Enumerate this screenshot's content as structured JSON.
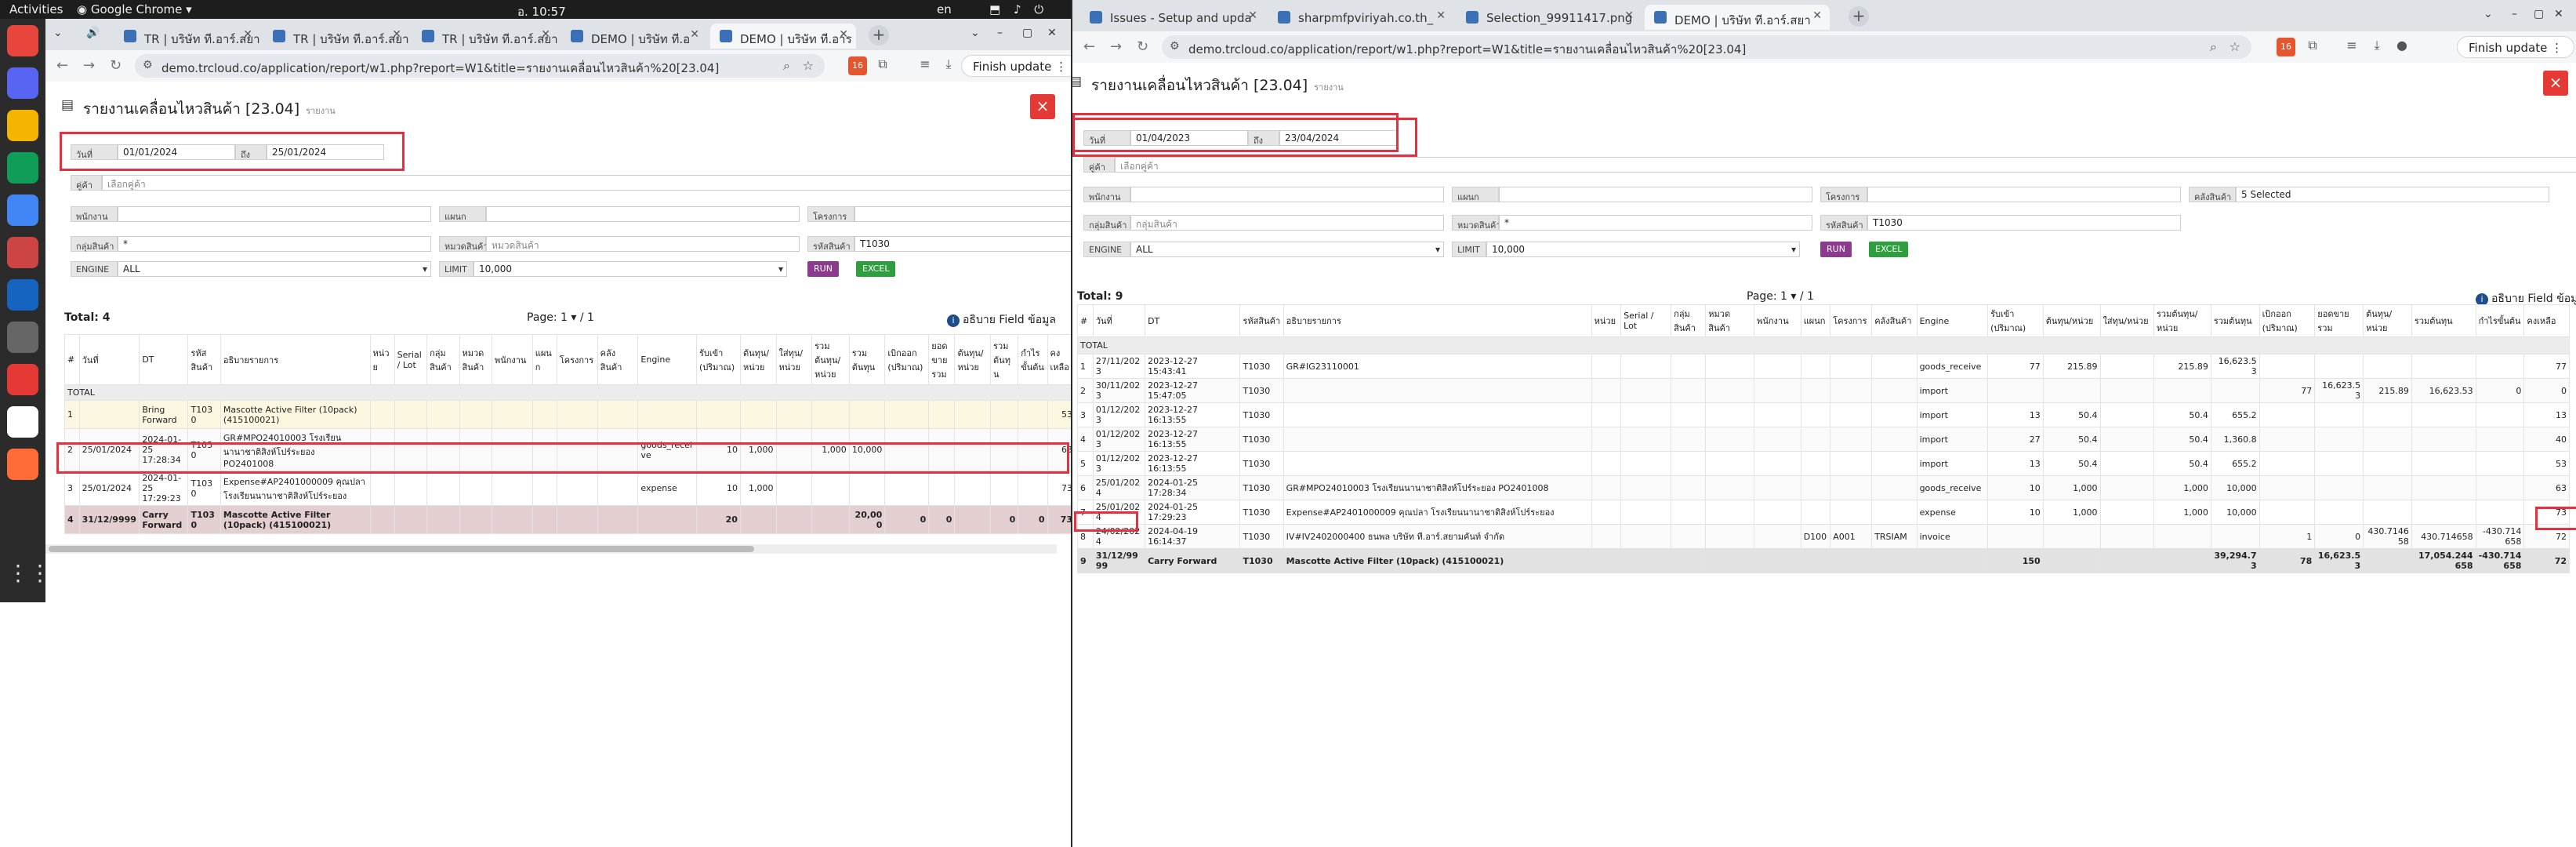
{
  "topbar": {
    "activities": "Activities",
    "app_name": "Google Chrome",
    "clock": "อ. 10:57",
    "lang": "en",
    "tray": "⬒ ♪ ⏻"
  },
  "dock": {
    "icons": [
      "chrome-icon",
      "discord-icon",
      "slides-icon",
      "sheets-icon",
      "docs-icon",
      "app-icon",
      "globe-icon",
      "calculator-icon",
      "anydesk-icon",
      "editor-icon",
      "postman-icon"
    ]
  },
  "left": {
    "tabs": [
      {
        "label": "TR | บริษัท ที.อาร์.สยา"
      },
      {
        "label": "TR | บริษัท ที.อาร์.สยา"
      },
      {
        "label": "TR | บริษัท ที.อาร์.สยา"
      },
      {
        "label": "DEMO | บริษัท ที.อ"
      },
      {
        "label": "DEMO | บริษัท ที.อาร"
      }
    ],
    "url": "demo.trcloud.co/application/report/w1.php?report=W1&title=รายงานเคลื่อนไหวสินค้า%20[23.04]",
    "ext_badge": "16",
    "finish_update": "Finish update",
    "report": {
      "title": "รายงานเคลื่อนไหวสินค้า [23.04]",
      "subtitle": "รายงาน",
      "date_label": "วันที่",
      "date_from": "01/01/2024",
      "to_label": "ถึง",
      "date_to": "25/01/2024",
      "customer_label": "คู่ค้า",
      "customer_placeholder": "เลือกคู่ค้า",
      "employee_label": "พนักงาน",
      "dept_label": "แผนก",
      "project_label": "โครงการ",
      "group_label": "กลุ่มสินค้า",
      "group_value": "*",
      "unit_label": "หมวดสินค้า",
      "unit_placeholder": "หมวดสินค้า",
      "code_label": "รหัสสินค้า",
      "code_value": "T1030",
      "engine_label": "ENGINE",
      "engine_value": "ALL",
      "limit_label": "LIMIT",
      "limit_value": "10,000",
      "run": "RUN",
      "excel": "EXCEL",
      "total": "Total: 4",
      "page": "Page: 1 ▾ / 1",
      "info": "อธิบาย Field ข้อมูล",
      "headers": [
        "#",
        "วันที่",
        "DT",
        "รหัสสินค้า",
        "อธิบายรายการ",
        "หน่วย",
        "Serial / Lot",
        "กลุ่มสินค้า",
        "หมวดสินค้า",
        "พนักงาน",
        "แผนก",
        "โครงการ",
        "คลังสินค้า",
        "Engine",
        "รับเข้า (ปริมาณ)",
        "ต้นทุน/หน่วย",
        "ใส่ทุน/หน่วย",
        "รวมต้นทุน/หน่วย",
        "รวมต้นทุน",
        "เบิกออก (ปริมาณ)",
        "ยอดขายรวม",
        "ต้นทุน/หน่วย",
        "รวมต้นทุน",
        "กำไรขั้นต้น",
        "คงเหลือ"
      ],
      "total_row": "TOTAL",
      "rows": [
        [
          "1",
          "",
          "Bring Forward",
          "T1030",
          "Mascotte Active Filter (10pack) (415100021)",
          "",
          "",
          "",
          "",
          "",
          "",
          "",
          "",
          "",
          "",
          "",
          "",
          "",
          "",
          "",
          "",
          "",
          "",
          "",
          "53"
        ],
        [
          "2",
          "25/01/2024",
          "2024-01-25 17:28:34",
          "T1030",
          "GR#MPO24010003 โรงเรียนนานาชาติสิงห์โปร์ระยอง PO2401008",
          "",
          "",
          "",
          "",
          "",
          "",
          "",
          "",
          "goods_receive",
          "10",
          "1,000",
          "",
          "1,000",
          "10,000",
          "",
          "",
          "",
          "",
          "",
          "63"
        ],
        [
          "3",
          "25/01/2024",
          "2024-01-25 17:29:23",
          "T1030",
          "Expense#AP2401000009 คุณปลา โรงเรียนนานาชาติสิงห์โปร์ระยอง",
          "",
          "",
          "",
          "",
          "",
          "",
          "",
          "",
          "expense",
          "10",
          "1,000",
          "",
          "",
          "",
          "",
          "",
          "",
          "",
          "",
          "73"
        ],
        [
          "4",
          "31/12/9999",
          "Carry Forward",
          "T1030",
          "Mascotte Active Filter (10pack) (415100021)",
          "",
          "",
          "",
          "",
          "",
          "",
          "",
          "",
          "",
          "20",
          "",
          "",
          "",
          "20,000",
          "0",
          "0",
          "",
          "0",
          "0",
          "73"
        ]
      ]
    }
  },
  "right": {
    "tabs": [
      {
        "label": "Issues - Setup and upda"
      },
      {
        "label": "sharpmfpviriyah.co.th_"
      },
      {
        "label": "Selection_99911417.png"
      },
      {
        "label": "DEMO | บริษัท ที.อาร์.สยา"
      }
    ],
    "url": "demo.trcloud.co/application/report/w1.php?report=W1&title=รายงานเคลื่อนไหวสินค้า%20[23.04]",
    "ext_badge": "16",
    "finish_update": "Finish update",
    "report": {
      "title": "รายงานเคลื่อนไหวสินค้า [23.04]",
      "subtitle": "รายงาน",
      "date_label": "วันที่",
      "date_from": "01/04/2023",
      "to_label": "ถึง",
      "date_to": "23/04/2024",
      "customer_label": "คู่ค้า",
      "customer_placeholder": "เลือกคู่ค้า",
      "employee_label": "พนักงาน",
      "dept_label": "แผนก",
      "project_label": "โครงการ",
      "warehouse_label": "คลังสินค้า",
      "warehouse_value": "5 Selected",
      "group_label": "กลุ่มสินค้า",
      "group_placeholder": "กลุ่มสินค้า",
      "unit_label": "หมวดสินค้า",
      "unit_value": "*",
      "code_label": "รหัสสินค้า",
      "code_value": "T1030",
      "engine_label": "ENGINE",
      "engine_value": "ALL",
      "limit_label": "LIMIT",
      "limit_value": "10,000",
      "run": "RUN",
      "excel": "EXCEL",
      "total": "Total: 9",
      "page": "Page: 1 ▾ / 1",
      "info": "อธิบาย Field ข้อมูล",
      "headers": [
        "#",
        "วันที่",
        "DT",
        "รหัสสินค้า",
        "อธิบายรายการ",
        "หน่วย",
        "Serial / Lot",
        "กลุ่มสินค้า",
        "หมวดสินค้า",
        "พนักงาน",
        "แผนก",
        "โครงการ",
        "คลังสินค้า",
        "Engine",
        "รับเข้า (ปริมาณ)",
        "ต้นทุน/หน่วย",
        "ใส่ทุน/หน่วย",
        "รวมต้นทุน/หน่วย",
        "รวมต้นทุน",
        "เบิกออก (ปริมาณ)",
        "ยอดขายรวม",
        "ต้นทุน/หน่วย",
        "รวมต้นทุน",
        "กำไรขั้นต้น",
        "คงเหลือ"
      ],
      "total_row": "TOTAL",
      "rows": [
        [
          "1",
          "27/11/2023",
          "2023-12-27 15:43:41",
          "T1030",
          "GR#IG23110001",
          "",
          "",
          "",
          "",
          "",
          "",
          "",
          "",
          "goods_receive",
          "77",
          "215.89",
          "",
          "215.89",
          "16,623.53",
          "",
          "",
          "",
          "",
          "",
          "77"
        ],
        [
          "2",
          "30/11/2023",
          "2023-12-27 15:47:05",
          "T1030",
          "",
          "",
          "",
          "",
          "",
          "",
          "",
          "",
          "",
          "import",
          "",
          "",
          "",
          "",
          "",
          "77",
          "16,623.53",
          "215.89",
          "16,623.53",
          "0",
          "0"
        ],
        [
          "3",
          "01/12/2023",
          "2023-12-27 16:13:55",
          "T1030",
          "",
          "",
          "",
          "",
          "",
          "",
          "",
          "",
          "",
          "import",
          "13",
          "50.4",
          "",
          "50.4",
          "655.2",
          "",
          "",
          "",
          "",
          "",
          "13"
        ],
        [
          "4",
          "01/12/2023",
          "2023-12-27 16:13:55",
          "T1030",
          "",
          "",
          "",
          "",
          "",
          "",
          "",
          "",
          "",
          "import",
          "27",
          "50.4",
          "",
          "50.4",
          "1,360.8",
          "",
          "",
          "",
          "",
          "",
          "40"
        ],
        [
          "5",
          "01/12/2023",
          "2023-12-27 16:13:55",
          "T1030",
          "",
          "",
          "",
          "",
          "",
          "",
          "",
          "",
          "",
          "import",
          "13",
          "50.4",
          "",
          "50.4",
          "655.2",
          "",
          "",
          "",
          "",
          "",
          "53"
        ],
        [
          "6",
          "25/01/2024",
          "2024-01-25 17:28:34",
          "T1030",
          "GR#MPO24010003 โรงเรียนนานาชาติสิงห์โปร์ระยอง PO2401008",
          "",
          "",
          "",
          "",
          "",
          "",
          "",
          "",
          "goods_receive",
          "10",
          "1,000",
          "",
          "1,000",
          "10,000",
          "",
          "",
          "",
          "",
          "",
          "63"
        ],
        [
          "7",
          "25/01/2024",
          "2024-01-25 17:29:23",
          "T1030",
          "Expense#AP2401000009 คุณปลา โรงเรียนนานาชาติสิงห์โปร์ระยอง",
          "",
          "",
          "",
          "",
          "",
          "",
          "",
          "",
          "expense",
          "10",
          "1,000",
          "",
          "1,000",
          "10,000",
          "",
          "",
          "",
          "",
          "",
          "73"
        ],
        [
          "8",
          "24/02/2024",
          "2024-04-19 16:14:37",
          "T1030",
          "IV#IV2402000400 ธนพล บริษัท ที.อาร์.สยามคันท์ จำกัด",
          "",
          "",
          "",
          "",
          "",
          "D100",
          "A001",
          "TRSIAM",
          "invoice",
          "",
          "",
          "",
          "",
          "",
          "1",
          "0",
          "430.714658",
          "430.714658",
          "-430.714658",
          "72"
        ],
        [
          "9",
          "31/12/9999",
          "Carry Forward",
          "T1030",
          "Mascotte Active Filter (10pack) (415100021)",
          "",
          "",
          "",
          "",
          "",
          "",
          "",
          "",
          "",
          "150",
          "",
          "",
          "",
          "39,294.73",
          "78",
          "16,623.53",
          "",
          "17,054.244658",
          "-430.714658",
          "72"
        ]
      ]
    }
  }
}
